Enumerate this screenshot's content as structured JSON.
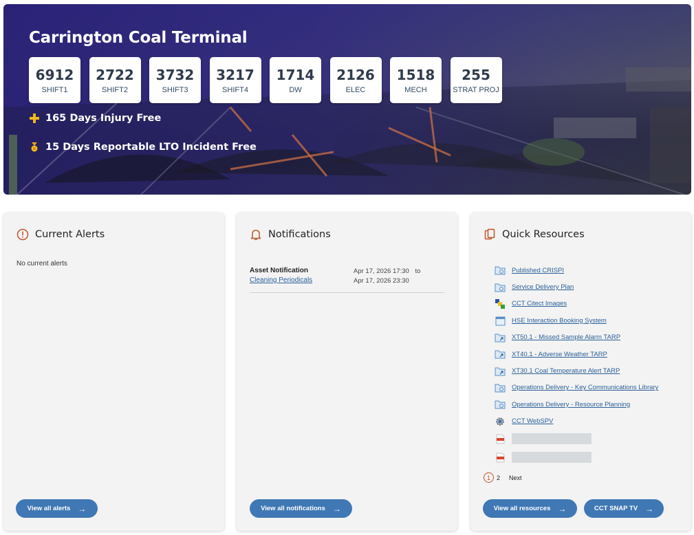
{
  "hero": {
    "title": "Carrington Coal Terminal",
    "stats": [
      {
        "value": "6912",
        "label": "SHIFT1"
      },
      {
        "value": "2722",
        "label": "SHIFT2"
      },
      {
        "value": "3732",
        "label": "SHIFT3"
      },
      {
        "value": "3217",
        "label": "SHIFT4"
      },
      {
        "value": "1714",
        "label": "DW"
      },
      {
        "value": "2126",
        "label": "ELEC"
      },
      {
        "value": "1518",
        "label": "MECH"
      },
      {
        "value": "255",
        "label": "STRAT PROJ"
      }
    ],
    "injury_free": "165 Days Injury Free",
    "lto_free": "15 Days Reportable LTO Incident Free"
  },
  "colors": {
    "accent": "#3f78b4",
    "alert_icon": "#c2552b",
    "hero_overlay": "#2c2478",
    "link": "#2a5f98"
  },
  "alerts": {
    "title": "Current Alerts",
    "icon": "exclamation-circle-icon",
    "empty_text": "No current alerts",
    "button_label": "View all alerts"
  },
  "notifications": {
    "title": "Notifications",
    "icon": "bell-icon",
    "items": [
      {
        "type": "Asset Notification",
        "link": "Cleaning Periodicals",
        "start": "Apr 17, 2026 17:30",
        "to": "to",
        "end": "Apr 17, 2026 23:30"
      }
    ],
    "button_label": "View all notifications"
  },
  "resources": {
    "title": "Quick Resources",
    "icon": "clipboard-copy-icon",
    "items": [
      {
        "label": "Published CRISPI",
        "icon": "folder-link-icon"
      },
      {
        "label": "Service Delivery Plan",
        "icon": "folder-link-icon"
      },
      {
        "label": "CCT Citect Images",
        "icon": "app-shortcut-icon"
      },
      {
        "label": "HSE Interaction Booking System",
        "icon": "calendar-icon"
      },
      {
        "label": "XT50.1 - Missed Sample Alarm TARP",
        "icon": "folder-shortcut-icon"
      },
      {
        "label": "XT40.1 - Adverse Weather TARP",
        "icon": "folder-shortcut-icon"
      },
      {
        "label": "XT30.1 Coal Temperature Alert TARP",
        "icon": "folder-shortcut-icon"
      },
      {
        "label": "Operations Delivery - Key Communications Library",
        "icon": "folder-link-icon"
      },
      {
        "label": "Operations Delivery - Resource Planning",
        "icon": "folder-link-icon"
      },
      {
        "label": "CCT WebSPV",
        "icon": "gear-globe-icon"
      },
      {
        "label": "",
        "icon": "pdf-icon"
      },
      {
        "label": "",
        "icon": "pdf-icon"
      }
    ],
    "pager": {
      "current": "1",
      "next_page": "2",
      "next_label": "Next"
    },
    "button_label": "View all resources",
    "snap_button_label": "CCT SNAP TV"
  }
}
